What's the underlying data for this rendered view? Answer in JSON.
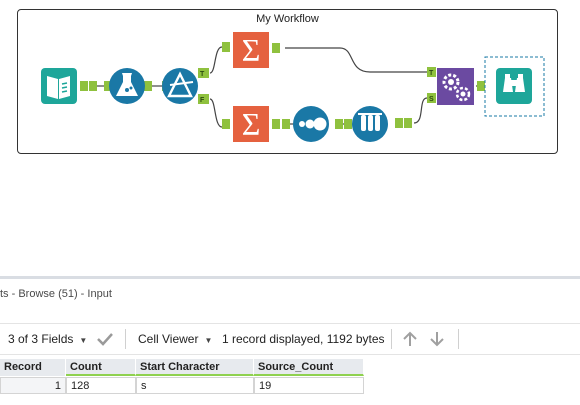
{
  "workflow": {
    "title": "My Workflow"
  },
  "tools": [
    {
      "name": "input-data-tool-icon",
      "color": "#1ea69a"
    },
    {
      "name": "formula-tool-icon",
      "color": "#1a78a6"
    },
    {
      "name": "filter-tool-icon",
      "color": "#1a78a6"
    },
    {
      "name": "summarize-tool-top-icon",
      "color": "#e5613f"
    },
    {
      "name": "summarize-tool-bottom-icon",
      "color": "#e5613f"
    },
    {
      "name": "record-id-tool-icon",
      "color": "#1a78a6"
    },
    {
      "name": "sample-tool-icon",
      "color": "#1a78a6"
    },
    {
      "name": "join-tool-icon",
      "color": "#6b4aa1"
    },
    {
      "name": "browse-tool-icon",
      "color": "#1ea69a"
    }
  ],
  "anchors": {
    "filter_true": "T",
    "filter_false": "F",
    "join_left": "T",
    "join_right": "S"
  },
  "results": {
    "header": "ts - Browse (51) - Input",
    "fields_label": "3 of 3 Fields",
    "viewer_label": "Cell Viewer",
    "status": "1 record displayed, 1192 bytes",
    "columns": [
      "Record",
      "Count",
      "Start Character",
      "Source_Count"
    ],
    "rows": [
      [
        "1",
        "128",
        "s",
        "19"
      ]
    ]
  },
  "colors": {
    "connector": "#8fc13e",
    "accent_green": "#8fd14f",
    "header_bg": "#e7eaee"
  }
}
